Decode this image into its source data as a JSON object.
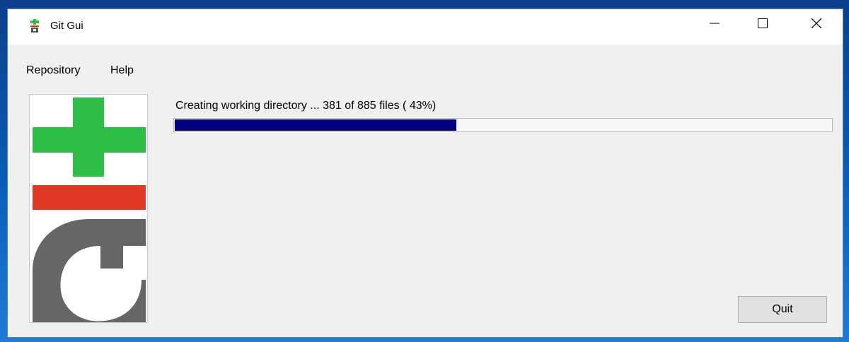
{
  "window": {
    "title": "Git Gui",
    "controls": {
      "minimize_icon": "minimize-icon",
      "maximize_icon": "maximize-icon",
      "close_icon": "close-icon"
    }
  },
  "menubar": {
    "items": [
      {
        "label": "Repository"
      },
      {
        "label": "Help"
      }
    ]
  },
  "logo": {
    "icon": "git-logo-icon",
    "colors": {
      "plus": "#2fbe45",
      "bar": "#e03a26",
      "g": "#666666"
    }
  },
  "status": {
    "text": "Creating working directory ... 381 of 885 files ( 43%)"
  },
  "progress": {
    "current": 381,
    "total": 885,
    "percent": 43,
    "fill_color": "#000080"
  },
  "actions": {
    "quit_label": "Quit"
  }
}
